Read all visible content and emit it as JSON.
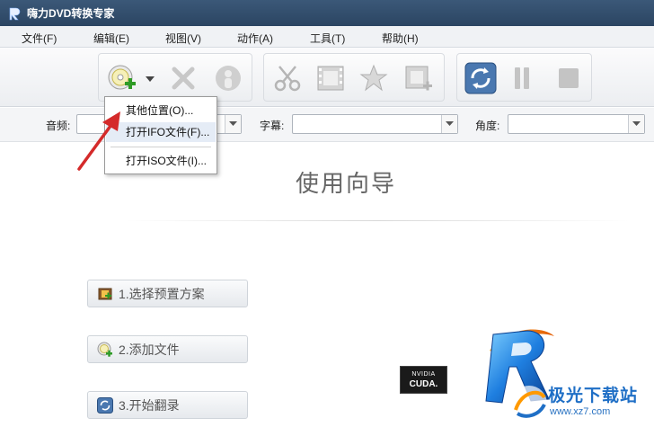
{
  "window": {
    "title": "嗨力DVD转换专家"
  },
  "menu": [
    "文件(F)",
    "编辑(E)",
    "视图(V)",
    "动作(A)",
    "工具(T)",
    "帮助(H)"
  ],
  "toolbar": {
    "add_icon": "add-disc-icon",
    "delete_icon": "delete-icon",
    "info_icon": "info-icon",
    "cut_icon": "scissors-icon",
    "film_icon": "film-icon",
    "effect_icon": "star-icon",
    "merge_icon": "film-add-icon",
    "convert_icon": "convert-icon",
    "pause_icon": "pause-icon",
    "stop_icon": "stop-icon"
  },
  "filters": {
    "audio_label": "音频:",
    "subtitle_label": "字幕:",
    "angle_label": "角度:"
  },
  "dropdown": {
    "items": [
      "其他位置(O)...",
      "打开IFO文件(F)...",
      "打开ISO文件(I)..."
    ],
    "highlighted_index": 1
  },
  "wizard": {
    "title": "使用向导",
    "steps": [
      "1.选择预置方案",
      "2.添加文件",
      "3.开始翻录"
    ]
  },
  "badge": {
    "top": "NVIDIA",
    "bottom": "CUDA."
  },
  "watermark": {
    "main": "极光下载站",
    "sub": "www.xz7.com"
  },
  "colors": {
    "titlebar": "#2f4a68",
    "accent": "#1f6fc6",
    "arrow": "#d42a2a"
  }
}
